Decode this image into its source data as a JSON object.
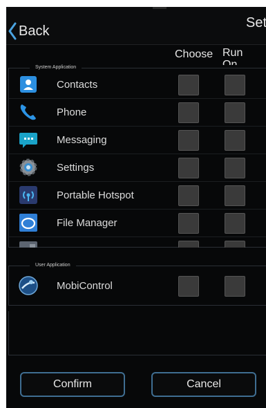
{
  "header": {
    "back_label": "Back",
    "title": "Set"
  },
  "columns": {
    "choose": "Choose",
    "run": "Run\nOn"
  },
  "system_group": {
    "label": "System Application",
    "apps": [
      {
        "label": "Contacts",
        "icon": "contacts-icon"
      },
      {
        "label": "Phone",
        "icon": "phone-icon"
      },
      {
        "label": "Messaging",
        "icon": "messaging-icon"
      },
      {
        "label": "Settings",
        "icon": "settings-gear-icon"
      },
      {
        "label": "Portable Hotspot",
        "icon": "hotspot-icon"
      },
      {
        "label": "File Manager",
        "icon": "file-manager-icon"
      },
      {
        "label": "",
        "icon": "calculator-icon"
      }
    ]
  },
  "user_group": {
    "label": "User Application",
    "apps": [
      {
        "label": "MobiControl",
        "icon": "mobicontrol-icon"
      }
    ]
  },
  "buttons": {
    "confirm": "Confirm",
    "cancel": "Cancel"
  },
  "colors": {
    "background": "#070809",
    "button_border": "#3f6e92",
    "checkbox": "#3a3a3a"
  }
}
